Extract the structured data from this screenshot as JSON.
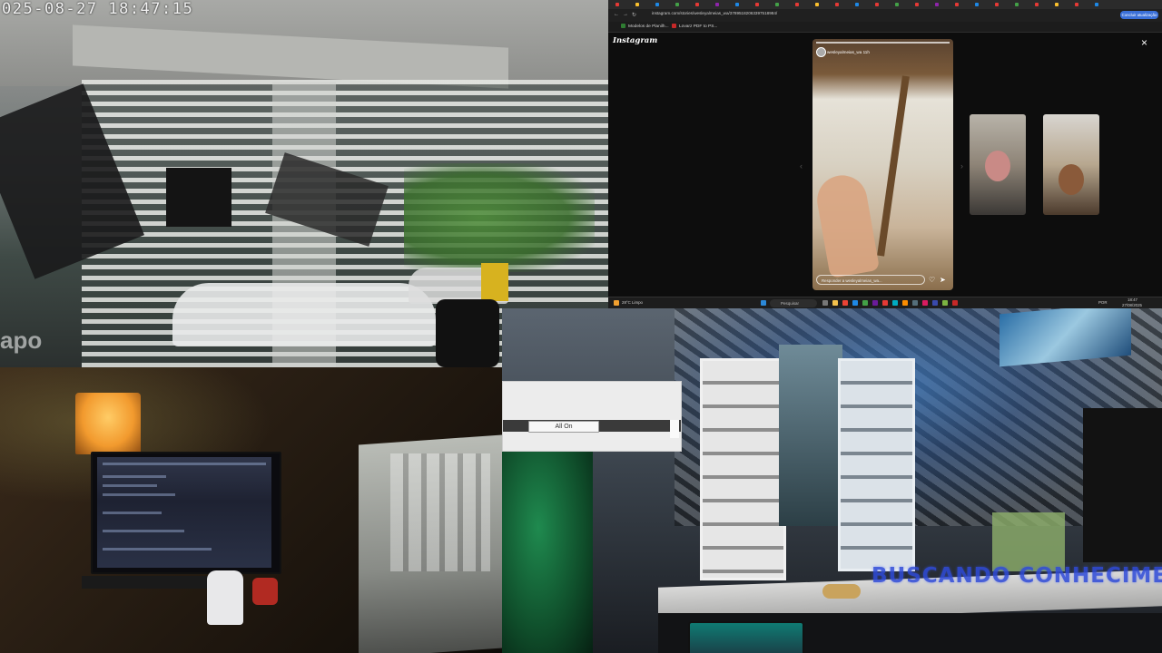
{
  "camera_top_left": {
    "timestamp": "025-08-27  18:47:15",
    "logo_text": "apo"
  },
  "browser": {
    "url": "instagram.com/stories/wesleyalmeias_wa/37895182063397518984/",
    "update_button": "Concluir atualização",
    "bookmarks": [
      {
        "label": "Modelos de Planilh...",
        "color": "#2f7d32"
      },
      {
        "label": "Lovarz PDF to PS...",
        "color": "#c62828"
      }
    ],
    "instagram_logo": "Instagram",
    "close_icon": "×",
    "story": {
      "username": "wesleyalmeias_wa  11h",
      "reply_placeholder": "Responder a wesleyalmeias_wa...",
      "like_icon": "♡",
      "send_icon": "➤"
    },
    "prev_arrow": "‹",
    "next_arrow": "›"
  },
  "taskbar": {
    "weather": "28°C Limpo",
    "search_placeholder": "Pesquisar",
    "language": "POR",
    "clock_time": "18:47",
    "clock_date": "27/08/2025"
  },
  "popup": {
    "all_on_button": "All On"
  },
  "overlay": {
    "banner_text": "BUSCANDO CONHECIMENTO"
  },
  "colors": {
    "overlay_text": "#2f4bd9",
    "update_button": "#3a6fd8"
  }
}
